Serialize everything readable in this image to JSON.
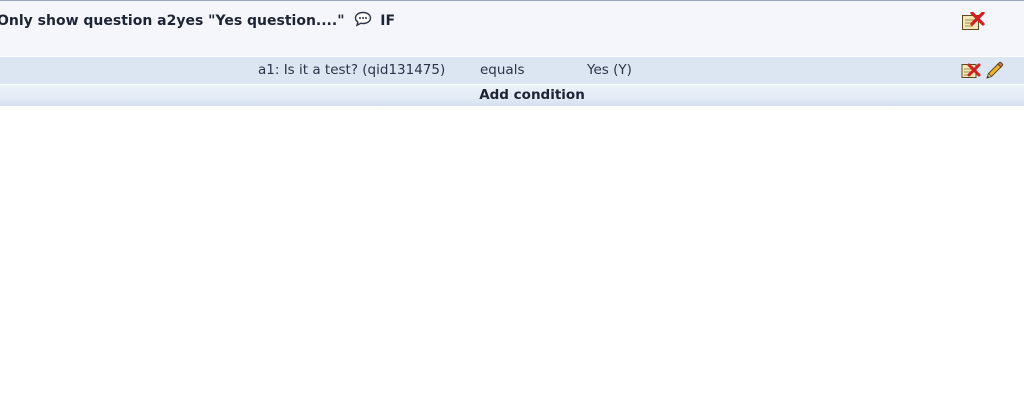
{
  "scenario": {
    "heading_prefix": "Only show question a2yes \"Yes question....\"",
    "heading_suffix": "IF"
  },
  "condition": {
    "question": "a1: Is it a test? (qid131475)",
    "operator": "equals",
    "value": "Yes (Y)"
  },
  "actions": {
    "add_condition_label": "Add condition"
  },
  "icons": {
    "comment": "speech-bubble-icon",
    "delete_scenario": "delete-scenario-icon",
    "delete_condition": "delete-condition-icon",
    "edit_condition": "pencil-icon"
  },
  "colors": {
    "header_bg": "#f5f6fc",
    "row_bg": "#dce6f3",
    "delete_red": "#d21f1f"
  }
}
